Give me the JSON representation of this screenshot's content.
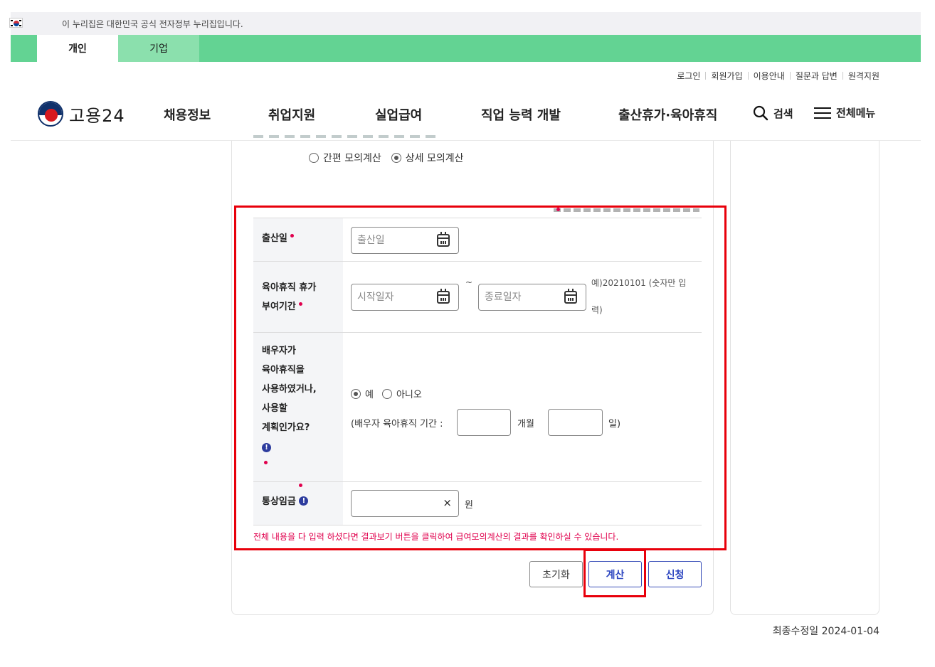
{
  "gov_banner": {
    "text": "이 누리집은 대한민국 공식 전자정부 누리집입니다."
  },
  "top_tabs": [
    {
      "label": "개인"
    },
    {
      "label": "기업"
    }
  ],
  "util_links": [
    "로그인",
    "회원가입",
    "이용안내",
    "질문과 답변",
    "원격지원"
  ],
  "header": {
    "logo_text": "고용24",
    "nav": [
      "채용정보",
      "취업지원",
      "실업급여",
      "직업 능력 개발",
      "출산휴가·육아휴직"
    ],
    "search_label": "검색",
    "menu_label": "전체메뉴"
  },
  "calc_type": {
    "options": [
      "간편 모의계산",
      "상세 모의계산"
    ],
    "selected": "상세 모의계산"
  },
  "form": {
    "birth": {
      "label": "출산일",
      "placeholder": "출산일"
    },
    "leave_period": {
      "label_line1": "육아휴직 휴가",
      "label_line2": "부여기간",
      "start_placeholder": "시작일자",
      "tilde": "~",
      "end_placeholder": "종료일자",
      "hint_line1": "예)20210101 (숫자만 입",
      "hint_line2": "력)"
    },
    "spouse": {
      "label_lines": [
        "배우자가",
        "육아휴직을",
        "사용하였거나,",
        "사용할",
        "계획인가요?"
      ],
      "options": [
        "예",
        "아니오"
      ],
      "selected": "예",
      "period_prefix": "(배우자 육아휴직 기간 :",
      "month_unit": "개월",
      "day_unit": "일)",
      "months_value": "",
      "days_value": ""
    },
    "wage": {
      "label": "통상임금",
      "value": "",
      "unit": "원",
      "clear_symbol": "×"
    }
  },
  "notice": "전체 내용을 다 입력 하셨다면 결과보기 버튼을 클릭하여 급여모의계산의 결과를 확인하실 수 있습니다.",
  "buttons": {
    "reset": "초기화",
    "calc": "계산",
    "apply": "신청"
  },
  "last_updated": "최종수정일 2024-01-04",
  "colors": {
    "nav_green": "#63d393",
    "accent_blue": "#2c45c0",
    "required_red": "#e0004d",
    "highlight_red": "#e8000b"
  }
}
